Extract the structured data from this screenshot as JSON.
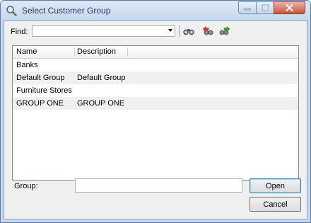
{
  "window": {
    "title": "Select Customer Group"
  },
  "toolbar": {
    "find_label": "Find:",
    "find_value": ""
  },
  "grid": {
    "columns": [
      "Name",
      "Description"
    ],
    "rows": [
      {
        "name": "Banks",
        "description": ""
      },
      {
        "name": "Default Group",
        "description": "Default Group"
      },
      {
        "name": "Furniture Stores",
        "description": ""
      },
      {
        "name": "GROUP ONE",
        "description": "GROUP ONE"
      }
    ]
  },
  "footer": {
    "group_label": "Group:",
    "group_value": "",
    "open_label": "Open",
    "cancel_label": "Cancel"
  },
  "colors": {
    "titlebar": "#c4d7ec",
    "client": "#f0f0f0",
    "close_button": "#c9553f"
  }
}
